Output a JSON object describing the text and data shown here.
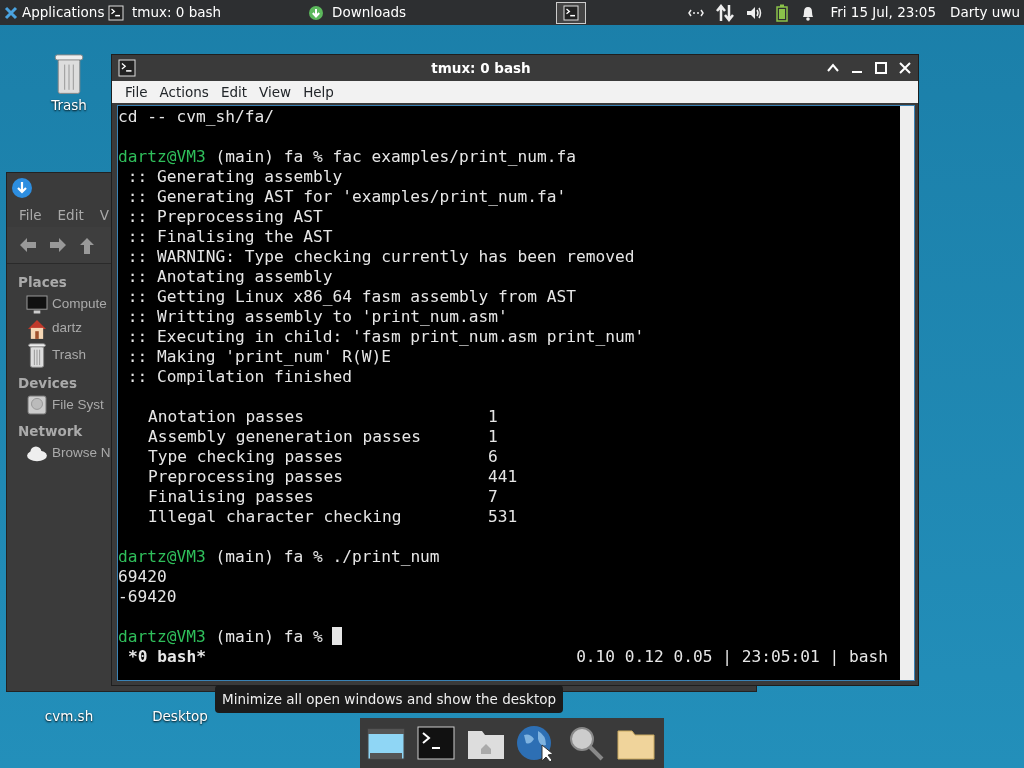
{
  "top_panel": {
    "apps_menu": "Applications",
    "tasks": [
      {
        "title": "tmux: 0 bash"
      },
      {
        "title": "Downloads"
      }
    ],
    "clock": "Fri 15 Jul, 23:05",
    "user": "Darty uwu"
  },
  "desktop_icons": [
    {
      "label": "Trash",
      "kind": "trash"
    },
    {
      "label": "cvm.sh",
      "kind": "file"
    },
    {
      "label": "Desktop",
      "kind": "folder"
    }
  ],
  "file_manager": {
    "menu": [
      "File",
      "Edit",
      "V"
    ],
    "sections": [
      {
        "title": "Places",
        "items": [
          {
            "label": "Compute"
          },
          {
            "label": "dartz"
          },
          {
            "label": "Trash"
          }
        ]
      },
      {
        "title": "Devices",
        "items": [
          {
            "label": "File Syst"
          }
        ]
      },
      {
        "title": "Network",
        "items": [
          {
            "label": "Browse N"
          }
        ]
      }
    ]
  },
  "terminal": {
    "title": "tmux: 0 bash",
    "menu": [
      "File",
      "Actions",
      "Edit",
      "View",
      "Help"
    ],
    "lines": [
      {
        "kind": "text",
        "text": "cd -- cvm_sh/fa/"
      },
      {
        "kind": "blank"
      },
      {
        "kind": "prompt",
        "user": "dartz@VM3",
        "text": " (main) fa % fac examples/print_num.fa"
      },
      {
        "kind": "text",
        "text": " :: Generating assembly"
      },
      {
        "kind": "text",
        "text": " :: Generating AST for 'examples/print_num.fa'"
      },
      {
        "kind": "text",
        "text": " :: Preprocessing AST"
      },
      {
        "kind": "text",
        "text": " :: Finalising the AST"
      },
      {
        "kind": "text",
        "text": " :: WARNING: Type checking currently has been removed"
      },
      {
        "kind": "text",
        "text": " :: Anotating assembly"
      },
      {
        "kind": "text",
        "text": " :: Getting Linux x86_64 fasm assembly from AST"
      },
      {
        "kind": "text",
        "text": " :: Writting assembly to 'print_num.asm'"
      },
      {
        "kind": "text",
        "text": " :: Executing in child: 'fasm print_num.asm print_num'"
      },
      {
        "kind": "text",
        "text": " :: Making 'print_num' R(W)E"
      },
      {
        "kind": "text",
        "text": " :: Compilation finished"
      },
      {
        "kind": "blank"
      },
      {
        "kind": "stat",
        "label": "Anotation passes",
        "value": "1"
      },
      {
        "kind": "stat",
        "label": "Assembly geneneration passes",
        "value": "1"
      },
      {
        "kind": "stat",
        "label": "Type checking passes",
        "value": "6"
      },
      {
        "kind": "stat",
        "label": "Preprocessing passes",
        "value": "441"
      },
      {
        "kind": "stat",
        "label": "Finalising passes",
        "value": "7"
      },
      {
        "kind": "stat",
        "label": "Illegal character checking",
        "value": "531"
      },
      {
        "kind": "blank"
      },
      {
        "kind": "prompt",
        "user": "dartz@VM3",
        "text": " (main) fa % ./print_num"
      },
      {
        "kind": "text",
        "text": "69420"
      },
      {
        "kind": "text",
        "text": "-69420"
      },
      {
        "kind": "blank"
      },
      {
        "kind": "prompt",
        "user": "dartz@VM3",
        "text": " (main) fa %",
        "cursor": true
      }
    ],
    "status_left": "*0 bash*",
    "status_right": "0.10 0.12 0.05 | 23:05:01 | bash"
  },
  "tooltip": "Minimize all open windows and show the desktop"
}
